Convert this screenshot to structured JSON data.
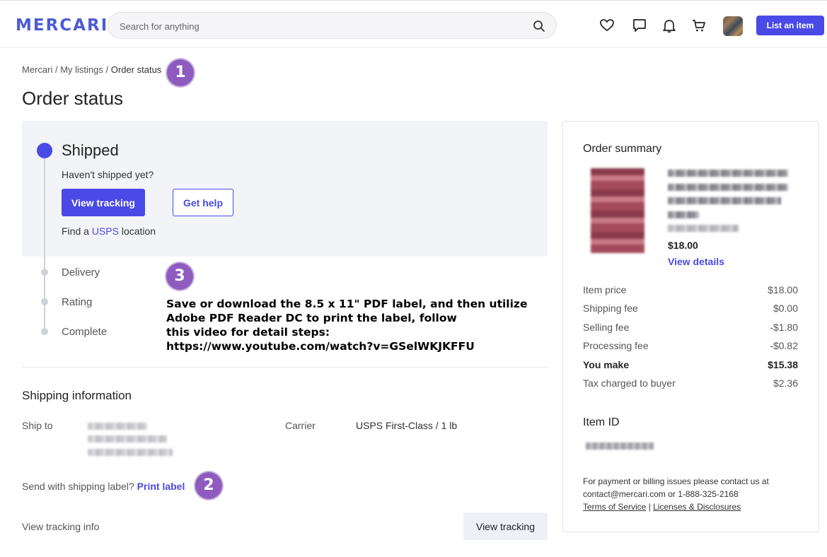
{
  "header": {
    "logo": "MERCARI",
    "search_placeholder": "Search for anything",
    "list_button": "List an item"
  },
  "breadcrumb": {
    "items": [
      "Mercari",
      "My listings"
    ],
    "separator": "/",
    "current": "Order status"
  },
  "page_title": "Order status",
  "status": {
    "active_step": "Shipped",
    "subtext": "Haven't shipped yet?",
    "view_tracking": "View tracking",
    "get_help": "Get help",
    "find_prefix": "Find a",
    "find_link": "USPS",
    "find_suffix": "location",
    "steps": [
      "Delivery",
      "Rating",
      "Complete"
    ]
  },
  "annotations": {
    "badge_1": "1",
    "badge_2": "2",
    "badge_3": "3",
    "note_lines": [
      "Save or download the 8.5 x 11\" PDF label, and then utilize",
      "Adobe PDF Reader DC to print the label, follow",
      "this video for detail steps:",
      "https://www.youtube.com/watch?v=GSelWKJKFFU"
    ]
  },
  "shipping": {
    "title": "Shipping information",
    "ship_to_label": "Ship to",
    "carrier_label": "Carrier",
    "carrier_value": "USPS First-Class / 1 lb",
    "send_label_prefix": "Send with shipping label?",
    "print_label": "Print label",
    "tracking_info_label": "View tracking info",
    "view_tracking_button": "View tracking"
  },
  "summary": {
    "title": "Order summary",
    "item_price": "$18.00",
    "view_details": "View details",
    "fees": [
      {
        "label": "Item price",
        "value": "$18.00",
        "bold": false
      },
      {
        "label": "Shipping fee",
        "value": "$0.00",
        "bold": false
      },
      {
        "label": "Selling fee",
        "value": "-$1.80",
        "bold": false
      },
      {
        "label": "Processing fee",
        "value": "-$0.82",
        "bold": false
      },
      {
        "label": "You make",
        "value": "$15.38",
        "bold": true
      },
      {
        "label": "Tax charged to buyer",
        "value": "$2.36",
        "bold": false
      }
    ],
    "item_id_title": "Item ID",
    "billing_text": "For payment or billing issues please contact us at",
    "billing_contact": "contact@mercari.com or 1-888-325-2168",
    "terms_link": "Terms of Service",
    "licenses_link": "Licenses & Disclosures",
    "links_separator": "|"
  },
  "colors": {
    "brand": "#4d5bd4",
    "primary": "#4a4ae6",
    "annotation_badge": "#8e5bbf",
    "panel_bg": "#f2f4f8"
  }
}
